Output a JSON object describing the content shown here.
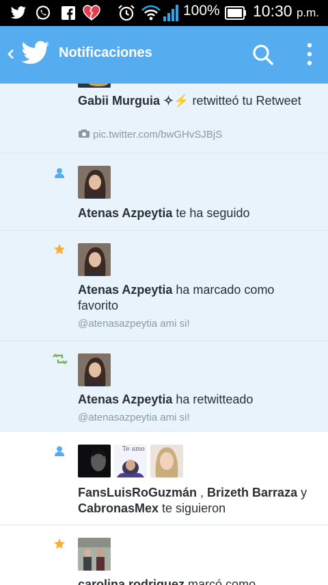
{
  "status_bar": {
    "battery_percent": "100%",
    "time": "10:30",
    "ampm": "p.m."
  },
  "app_bar": {
    "title": "Notificaciones",
    "icons": [
      "back-chevron-icon",
      "twitter-bird-icon",
      "search-icon",
      "more-vert-icon"
    ]
  },
  "notifications": [
    {
      "type": "retweet-of-retweet",
      "user": "Gabii Murguia ✧⚡",
      "action": " retwitteó tu Retweet",
      "link": "pic.twitter.com/bwGHvSJBjS"
    },
    {
      "type": "follow",
      "user": "Atenas Azpeytia",
      "action": " te ha seguido"
    },
    {
      "type": "favorite",
      "user": "Atenas Azpeytia",
      "action": " ha marcado como favorito",
      "tweet": "@atenasazpeytia ami si!"
    },
    {
      "type": "retweet",
      "user": "Atenas Azpeytia",
      "action": " ha retwitteado",
      "tweet": "@atenasazpeytia ami si!"
    },
    {
      "type": "follow",
      "user1": "FansLuisRoGuzmán",
      "sep1": " , ",
      "user2": "Brizeth Barraza",
      "sep2": " y ",
      "user3": "CabronasMex",
      "action": " te siguieron",
      "avatar_caption": "Te amo"
    },
    {
      "type": "favorite",
      "user": "carolina rodriguez",
      "action": " marcó como"
    }
  ],
  "colors": {
    "twitter_blue": "#55acee",
    "unread_bg": "#e8f3fb",
    "follow_icon": "#55acee",
    "favorite_icon": "#ffac33",
    "retweet_icon": "#77b255"
  }
}
